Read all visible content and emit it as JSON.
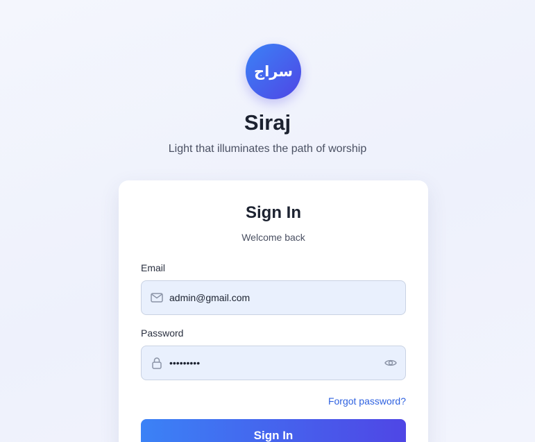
{
  "brand": {
    "logo_text": "سراج",
    "title": "Siraj",
    "tagline": "Light that illuminates the path of worship"
  },
  "signin_card": {
    "title": "Sign In",
    "subtitle": "Welcome back",
    "email": {
      "label": "Email",
      "value": "admin@gmail.com",
      "icon": "mail-icon"
    },
    "password": {
      "label": "Password",
      "value": "•••••••••",
      "icon": "lock-icon",
      "toggle_icon": "eye-icon"
    },
    "forgot_password_label": "Forgot password?",
    "submit_label": "Sign In"
  },
  "colors": {
    "accent_start": "#3b82f6",
    "accent_end": "#4f46e5",
    "link": "#2f62e0",
    "input_bg": "#e9f0fd"
  }
}
